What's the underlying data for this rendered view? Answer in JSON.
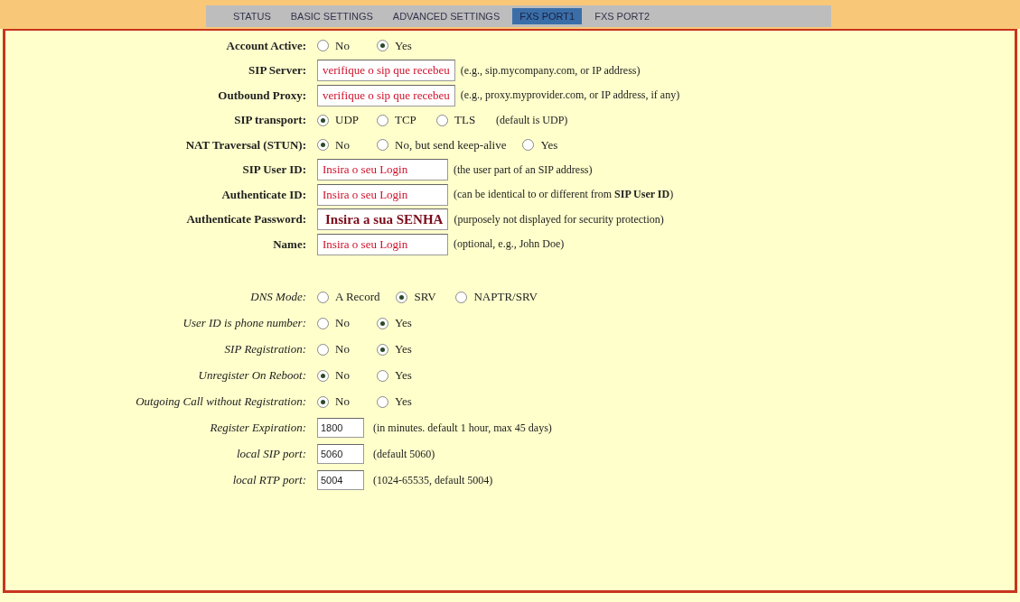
{
  "tabs": [
    {
      "label": "STATUS",
      "selected": false
    },
    {
      "label": "BASIC SETTINGS",
      "selected": false
    },
    {
      "label": "ADVANCED SETTINGS",
      "selected": false
    },
    {
      "label": "FXS PORT1",
      "selected": true
    },
    {
      "label": "FXS PORT2",
      "selected": false
    }
  ],
  "sections": [
    {
      "rows": [
        {
          "kind": "radio",
          "label": "Account Active:",
          "options": [
            {
              "label": "No",
              "selected": false
            },
            {
              "label": "Yes",
              "selected": true
            }
          ]
        },
        {
          "kind": "text",
          "label": "SIP Server:",
          "value": "verifique o sip que recebeu",
          "note": "(e.g., sip.mycompany.com, or IP address)"
        },
        {
          "kind": "text",
          "label": "Outbound Proxy:",
          "value": "verifique o sip que recebeu",
          "note": "(e.g., proxy.myprovider.com, or IP address, if any)"
        },
        {
          "kind": "radio",
          "label": "SIP transport:",
          "options": [
            {
              "label": "UDP",
              "selected": true
            },
            {
              "label": "TCP",
              "selected": false
            },
            {
              "label": "TLS",
              "selected": false
            }
          ],
          "note": "(default is UDP)"
        },
        {
          "kind": "radio",
          "label": "NAT Traversal (STUN):",
          "options": [
            {
              "label": "No",
              "selected": true
            },
            {
              "label": "No, but send keep-alive",
              "selected": false
            },
            {
              "label": "Yes",
              "selected": false
            }
          ]
        },
        {
          "kind": "text",
          "label": "SIP User ID:",
          "value": "Insira o seu Login",
          "note": "(the user part of an SIP address)"
        },
        {
          "kind": "text",
          "label": "Authenticate ID:",
          "value": "Insira o seu Login",
          "note": "(can be identical to or different from **SIP User ID**)"
        },
        {
          "kind": "password",
          "label": "Authenticate Password:",
          "value": "Insira a sua SENHA",
          "note": "(purposely not displayed for security protection)"
        },
        {
          "kind": "text",
          "label": "Name:",
          "value": "Insira o seu Login",
          "note": "(optional, e.g., John Doe)"
        }
      ]
    },
    {
      "rows": [
        {
          "kind": "radio",
          "label": "DNS Mode:",
          "options": [
            {
              "label": "A Record",
              "selected": false
            },
            {
              "label": "SRV",
              "selected": true
            },
            {
              "label": "NAPTR/SRV",
              "selected": false
            }
          ]
        },
        {
          "kind": "radio",
          "label": "User ID is phone number:",
          "options": [
            {
              "label": "No",
              "selected": false
            },
            {
              "label": "Yes",
              "selected": true
            }
          ]
        },
        {
          "kind": "radio",
          "label": "SIP Registration:",
          "options": [
            {
              "label": "No",
              "selected": false
            },
            {
              "label": "Yes",
              "selected": true
            }
          ]
        },
        {
          "kind": "radio",
          "label": "Unregister On Reboot:",
          "options": [
            {
              "label": "No",
              "selected": true
            },
            {
              "label": "Yes",
              "selected": false
            }
          ]
        },
        {
          "kind": "radio",
          "label": "Outgoing Call without Registration:",
          "options": [
            {
              "label": "No",
              "selected": true
            },
            {
              "label": "Yes",
              "selected": false
            }
          ]
        },
        {
          "kind": "short",
          "label": "Register Expiration:",
          "value": "1800",
          "note": "(in minutes. default 1 hour, max 45 days)"
        },
        {
          "kind": "short",
          "label": "local SIP port:",
          "value": "5060",
          "note": "(default 5060)"
        },
        {
          "kind": "short",
          "label": "local RTP port:",
          "value": "5004",
          "note": "(1024-65535, default 5004)"
        }
      ]
    }
  ]
}
